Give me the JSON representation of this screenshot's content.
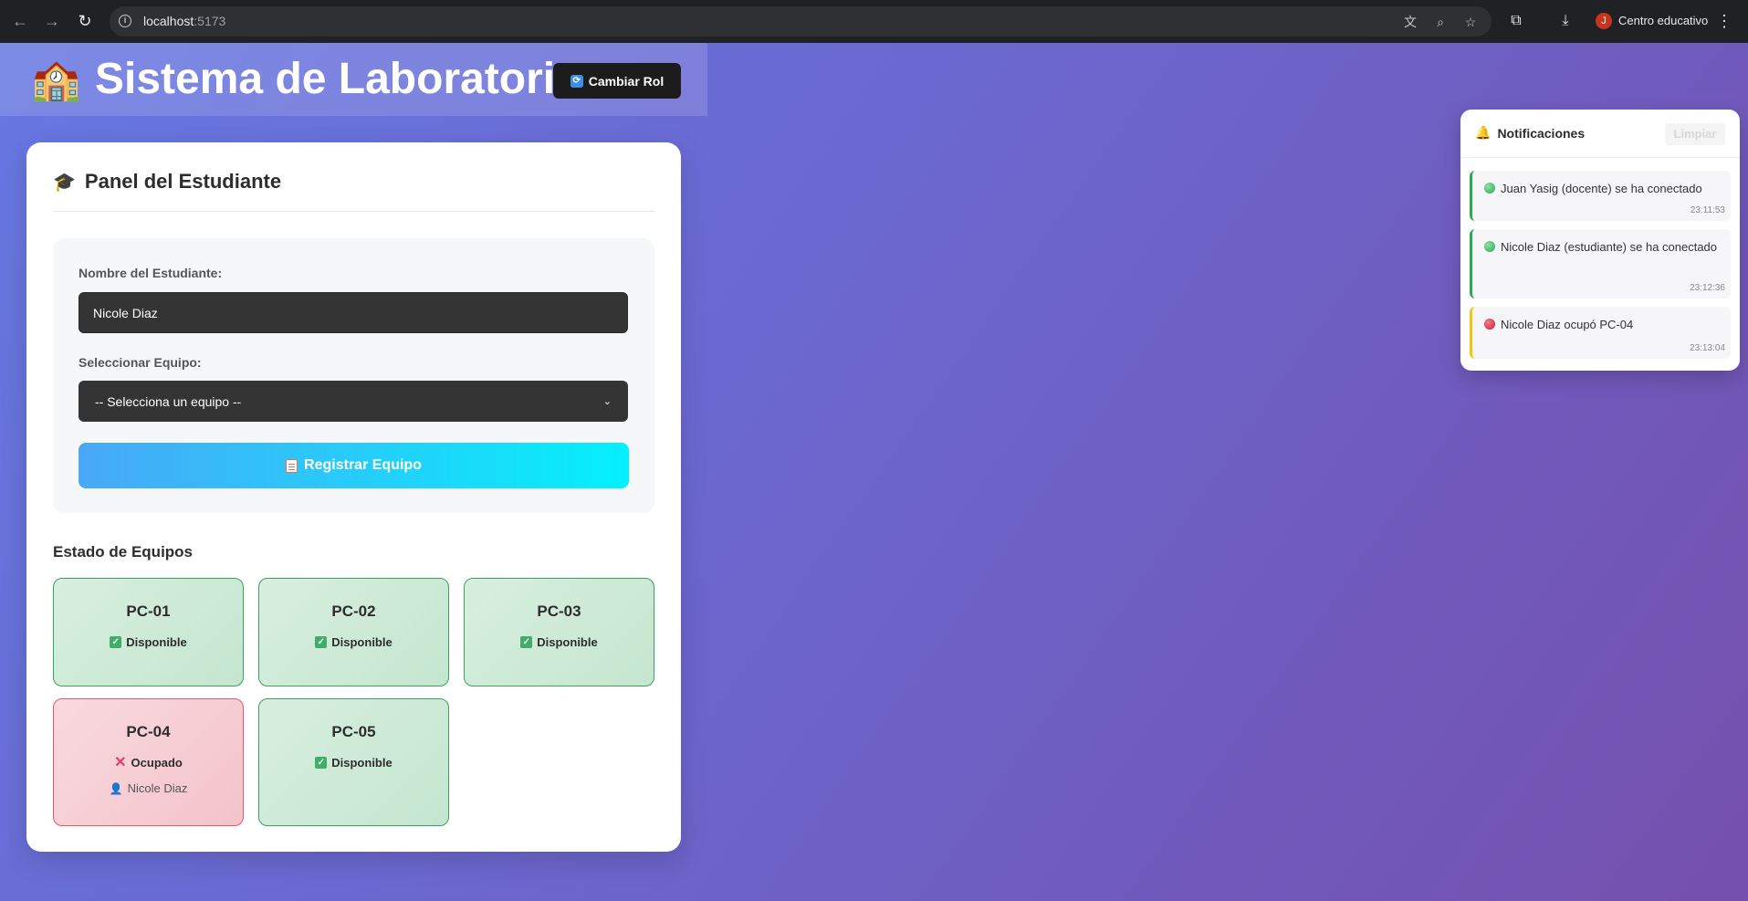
{
  "browser": {
    "url_host": "localhost",
    "url_port": ":5173",
    "profile_initial": "J",
    "profile_name": "Centro educativo"
  },
  "header": {
    "logo_emoji": "🏫",
    "title": "Sistema de Laboratorio",
    "role_button": "Cambiar Rol"
  },
  "panel": {
    "icon_emoji": "🎓",
    "title": "Panel del Estudiante",
    "name_label": "Nombre del Estudiante:",
    "name_value": "Nicole Diaz",
    "equip_label": "Seleccionar Equipo:",
    "equip_selected": "-- Selecciona un equipo --",
    "register_button": "Registrar Equipo",
    "equip_section_title": "Estado de Equipos",
    "equipment": [
      {
        "name": "PC-01",
        "status": "Disponible",
        "state": "free"
      },
      {
        "name": "PC-02",
        "status": "Disponible",
        "state": "free"
      },
      {
        "name": "PC-03",
        "status": "Disponible",
        "state": "free"
      },
      {
        "name": "PC-04",
        "status": "Ocupado",
        "state": "busy",
        "user": "Nicole Diaz"
      },
      {
        "name": "PC-05",
        "status": "Disponible",
        "state": "free"
      }
    ]
  },
  "notifications": {
    "title": "Notificaciones",
    "clear_button": "Limpiar",
    "items": [
      {
        "text": "Juan Yasig (docente) se ha conectado",
        "time": "23:11:53",
        "type": "ok"
      },
      {
        "text": "Nicole Diaz (estudiante) se ha conectado",
        "time": "23:12:36",
        "type": "ok"
      },
      {
        "text": "Nicole Diaz ocupó PC-04",
        "time": "23:13:04",
        "type": "warn"
      }
    ]
  },
  "colors": {
    "accent_green": "#3aa35b",
    "accent_red": "#e05b6a",
    "button_gradient_start": "#49a8f7",
    "button_gradient_end": "#05f0fb"
  }
}
